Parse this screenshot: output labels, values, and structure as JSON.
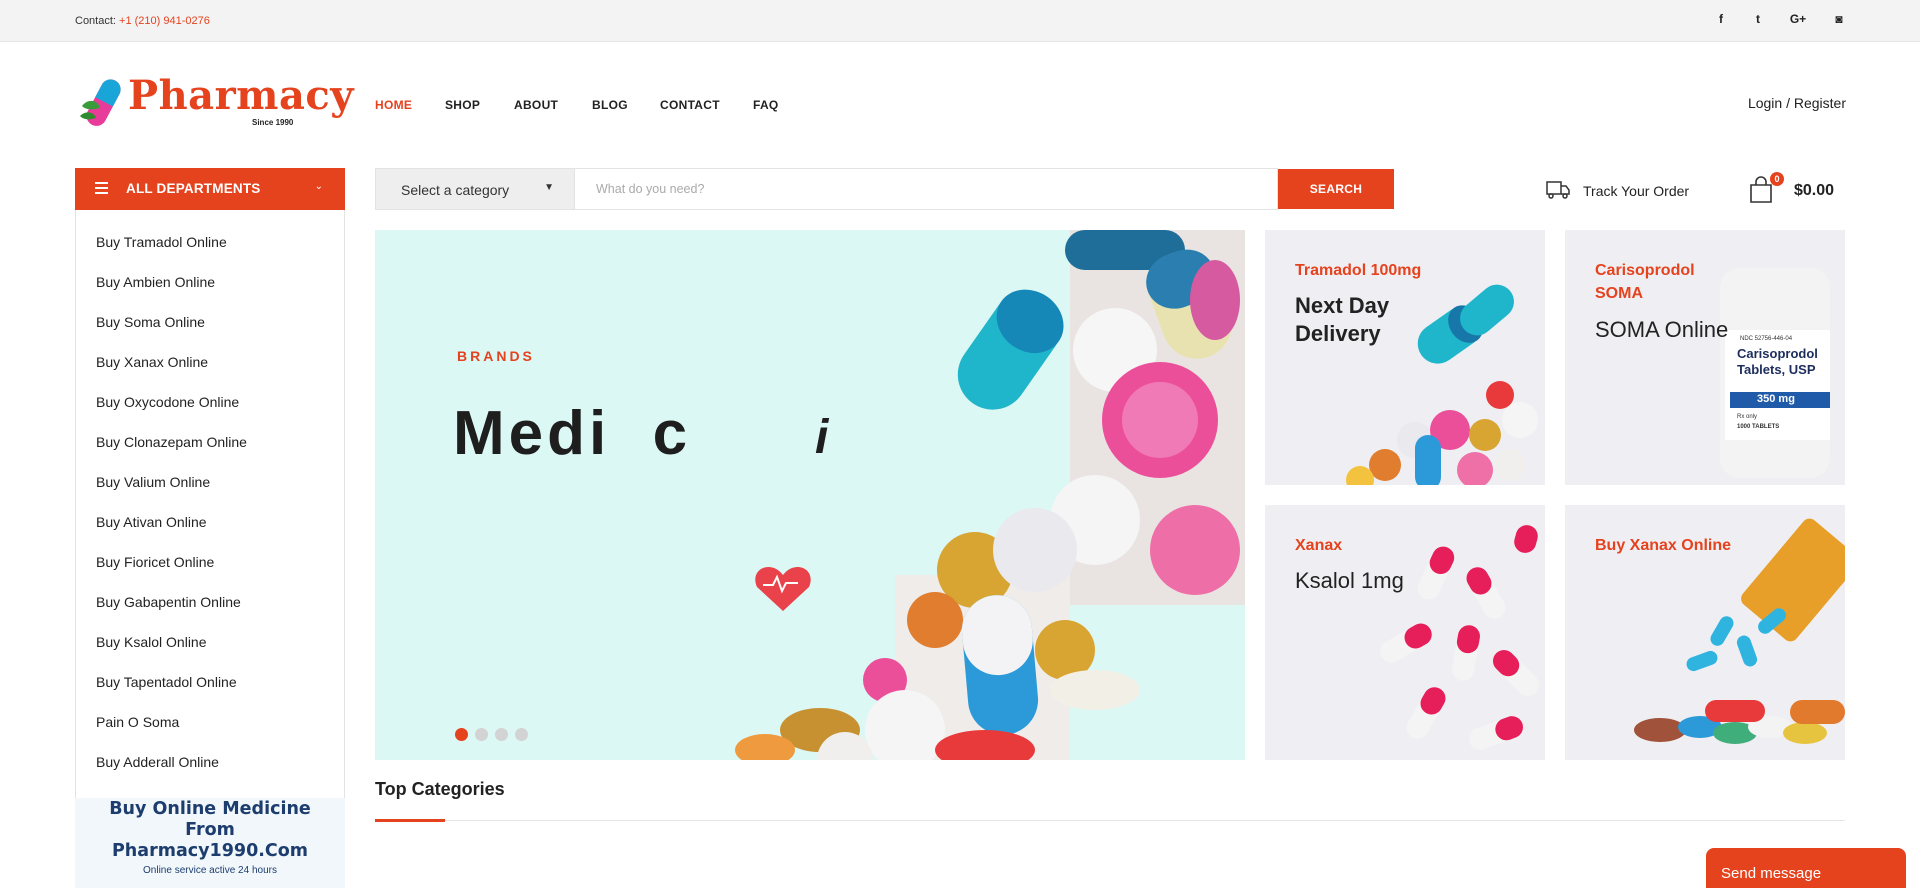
{
  "topbar": {
    "contact_label": "Contact:",
    "phone": "+1 (210) 941-0276",
    "social": [
      {
        "icon": "facebook-icon",
        "glyph": "f"
      },
      {
        "icon": "twitter-icon",
        "glyph": "t"
      },
      {
        "icon": "google-plus-icon",
        "glyph": "G+"
      },
      {
        "icon": "instagram-icon",
        "glyph": "◙"
      }
    ]
  },
  "header": {
    "logo_text": "Pharmacy",
    "logo_since": "Since 1990",
    "nav": [
      "HOME",
      "SHOP",
      "ABOUT",
      "BLOG",
      "CONTACT",
      "FAQ"
    ],
    "active_nav": "HOME",
    "login_label": "Login / Register"
  },
  "departments": {
    "title": "ALL DEPARTMENTS",
    "items": [
      "Buy Tramadol Online",
      "Buy Ambien Online",
      "Buy Soma Online",
      "Buy Xanax Online",
      "Buy Oxycodone Online",
      "Buy Clonazepam Online",
      "Buy Valium Online",
      "Buy Ativan Online",
      "Buy Fioricet Online",
      "Buy Gabapentin Online",
      "Buy Ksalol Online",
      "Buy Tapentadol Online",
      "Pain O Soma",
      "Buy Adderall Online"
    ]
  },
  "promo": {
    "line1": "Buy Online Medicine",
    "line2": "From",
    "line3": "Pharmacy1990.Com",
    "sub": "Online service active 24 hours"
  },
  "search": {
    "category_selected": "Select a category",
    "placeholder": "What do you need?",
    "button_label": "SEARCH"
  },
  "track_order_label": "Track Your Order",
  "cart": {
    "count": "0",
    "total": "$0.00"
  },
  "hero": {
    "eyebrow": "BRANDS",
    "headline": "Medi  c",
    "headline_tail": "i",
    "active_slide": 1,
    "slide_count": 4
  },
  "banners": [
    {
      "title": "Tramadol 100mg",
      "subtitle": "Next Day Delivery"
    },
    {
      "title": "Carisoprodol SOMA",
      "subtitle": "SOMA Online",
      "bottle_lines": [
        "NDC 52756-446-04",
        "Carisoprodol",
        "Tablets, USP",
        "350 mg",
        "Rx only",
        "1000 TABLETS"
      ]
    },
    {
      "title": "Xanax",
      "subtitle": "Ksalol 1mg"
    },
    {
      "title": "Buy Xanax Online",
      "subtitle": ""
    }
  ],
  "section_title": "Top Categories",
  "chat_button": "Send message",
  "colors": {
    "accent": "#e5421e",
    "hero_bg": "#dcf8f4",
    "banner_bg": "#efeff3"
  }
}
